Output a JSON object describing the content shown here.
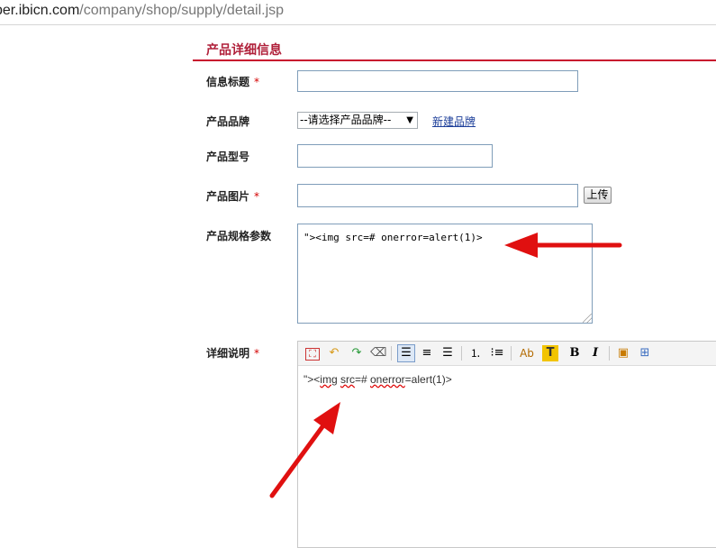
{
  "browser": {
    "url_domain": "per.ibicn.com",
    "url_path": "/company/shop/supply/detail.jsp"
  },
  "section": {
    "title": "产品详细信息"
  },
  "form": {
    "info_title": {
      "label": "信息标题",
      "required_mark": "*",
      "value": ""
    },
    "brand": {
      "label": "产品品牌",
      "selected": "--请选择产品品牌--",
      "new_brand_link": "新建品牌"
    },
    "model": {
      "label": "产品型号",
      "value": ""
    },
    "image": {
      "label": "产品图片",
      "required_mark": "*",
      "value": "",
      "upload_label": "上传"
    },
    "specs": {
      "label": "产品规格参数",
      "value": "\"><img src=# onerror=alert(1)>"
    },
    "detail": {
      "label": "详细说明",
      "required_mark": "*",
      "content_prefix": "\"><",
      "content_img": "img",
      "content_space1": " ",
      "content_src": "src",
      "content_mid": "=# ",
      "content_onerror": "onerror",
      "content_suffix": "=alert(1)>",
      "toolbar": {
        "icons": [
          "source-code-icon",
          "undo-icon",
          "redo-icon",
          "eraser-icon",
          "align-left-icon",
          "align-center-icon",
          "align-right-icon",
          "ordered-list-icon",
          "unordered-list-icon",
          "font-color-icon",
          "highlight-icon",
          "bold-icon",
          "italic-icon",
          "insert-image-icon",
          "insert-table-icon"
        ],
        "font_color_glyph": "Ab",
        "highlight_glyph": "T",
        "bold_glyph": "B",
        "italic_glyph": "I"
      }
    }
  },
  "colors": {
    "accent_red": "#c8102e",
    "title_red": "#b0203a",
    "arrow_red": "#e01010",
    "link_blue": "#1d3f9a"
  }
}
